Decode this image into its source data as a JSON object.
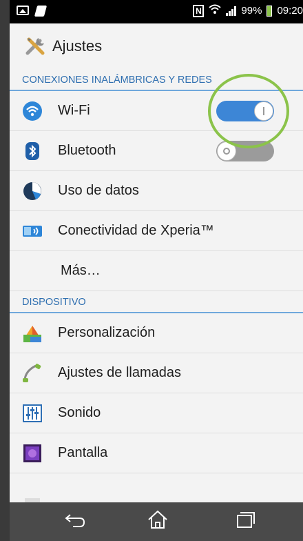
{
  "status_bar": {
    "battery": "99%",
    "time": "09:20"
  },
  "header": {
    "title": "Ajustes",
    "icon": "tools-icon"
  },
  "sections": [
    {
      "title": "CONEXIONES INALÁMBRICAS Y REDES",
      "items": [
        {
          "label": "Wi-Fi",
          "icon": "wifi-icon",
          "toggle": "on"
        },
        {
          "label": "Bluetooth",
          "icon": "bluetooth-icon",
          "toggle": "off"
        },
        {
          "label": "Uso de datos",
          "icon": "data-usage-icon"
        },
        {
          "label": "Conectividad de Xperia™",
          "icon": "xperia-connectivity-icon"
        },
        {
          "label": "Más…"
        }
      ]
    },
    {
      "title": "DISPOSITIVO",
      "items": [
        {
          "label": "Personalización",
          "icon": "personalization-icon"
        },
        {
          "label": "Ajustes de llamadas",
          "icon": "phone-handset-icon"
        },
        {
          "label": "Sonido",
          "icon": "equalizer-icon"
        },
        {
          "label": "Pantalla",
          "icon": "display-icon"
        }
      ]
    }
  ],
  "navbar": {
    "buttons": [
      "back-icon",
      "home-icon",
      "recents-icon"
    ]
  },
  "colors": {
    "accent": "#3d86d6",
    "section_text": "#2f6fb0",
    "highlight_circle": "#8bc34a"
  }
}
